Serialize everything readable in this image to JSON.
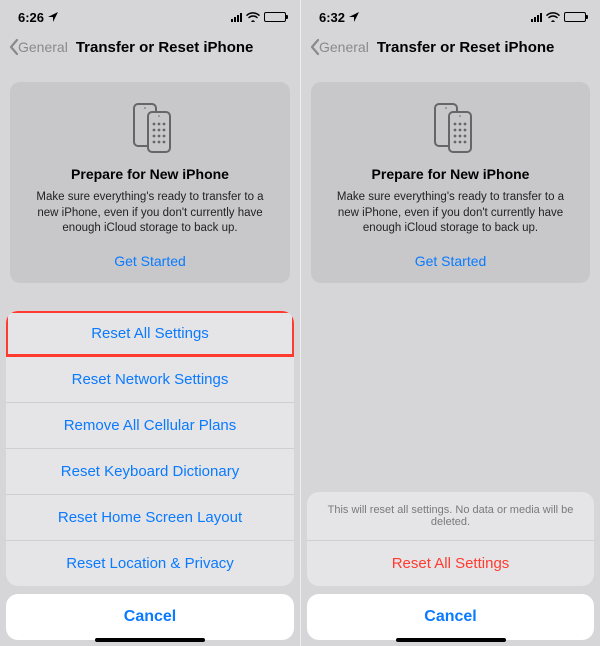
{
  "left": {
    "status": {
      "time": "6:26"
    },
    "nav": {
      "back": "General",
      "title": "Transfer or Reset iPhone"
    },
    "card": {
      "heading": "Prepare for New iPhone",
      "body": "Make sure everything's ready to transfer to a new iPhone, even if you don't currently have enough iCloud storage to back up.",
      "cta": "Get Started"
    },
    "menu": {
      "items": [
        "Reset All Settings",
        "Reset Network Settings",
        "Remove All Cellular Plans",
        "Reset Keyboard Dictionary",
        "Reset Home Screen Layout",
        "Reset Location & Privacy"
      ]
    },
    "cancel": "Cancel"
  },
  "right": {
    "status": {
      "time": "6:32"
    },
    "nav": {
      "back": "General",
      "title": "Transfer or Reset iPhone"
    },
    "card": {
      "heading": "Prepare for New iPhone",
      "body": "Make sure everything's ready to transfer to a new iPhone, even if you don't currently have enough iCloud storage to back up.",
      "cta": "Get Started"
    },
    "confirm": {
      "info": "This will reset all settings. No data or media will be deleted.",
      "action": "Reset All Settings"
    },
    "cancel": "Cancel"
  }
}
